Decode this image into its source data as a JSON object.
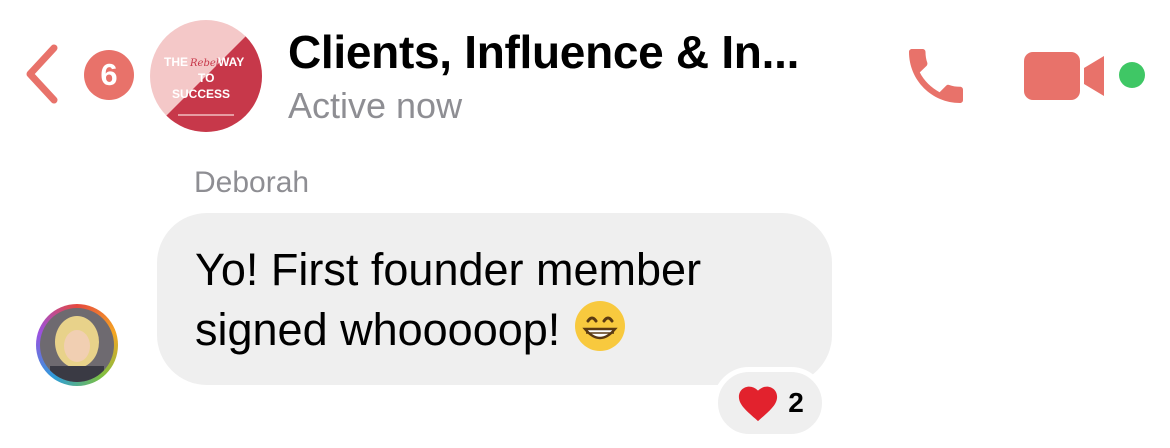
{
  "header": {
    "back_badge": "6",
    "title": "Clients, Influence & In...",
    "status": "Active now",
    "group_avatar_text": {
      "line1_start": "THE",
      "line1_script": "Rebel",
      "line1_end": "WAY",
      "line2": "TO",
      "line3": "SUCCESS"
    }
  },
  "message": {
    "sender": "Deborah",
    "text": "Yo!  First founder member signed whooooop!",
    "reaction": {
      "emoji": "heart-icon",
      "count": "2"
    }
  },
  "colors": {
    "accent": "#e8726a",
    "online": "#3fc765",
    "bubble": "#efefef",
    "muted_text": "#8e8e93"
  }
}
